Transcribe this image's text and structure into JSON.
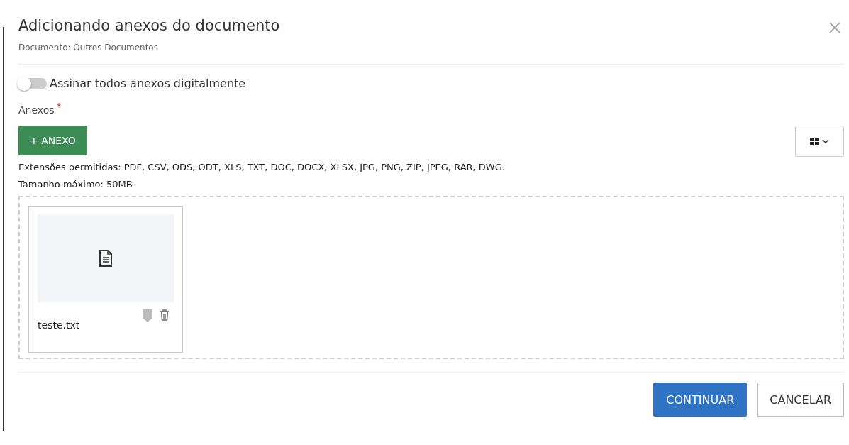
{
  "dialog": {
    "title": "Adicionando anexos do documento",
    "subtitle": "Documento: Outros Documentos"
  },
  "sign_toggle": {
    "label": "Assinar todos anexos digitalmente",
    "on": false
  },
  "attachments": {
    "label": "Anexos",
    "required_mark": "*",
    "add_button": "+ ANEXO",
    "extensions": "Extensões permitidas: PDF, CSV, ODS, ODT, XLS, TXT, DOC, DOCX, XLSX, JPG, PNG, ZIP, JPEG, RAR, DWG.",
    "max_size": "Tamanho máximo: 50MB",
    "files": [
      {
        "name": "teste.txt"
      }
    ]
  },
  "buttons": [
    {
      "label": "CONTINUAR",
      "kind": "primary"
    },
    {
      "label": "CANCELAR",
      "kind": "secondary"
    }
  ]
}
